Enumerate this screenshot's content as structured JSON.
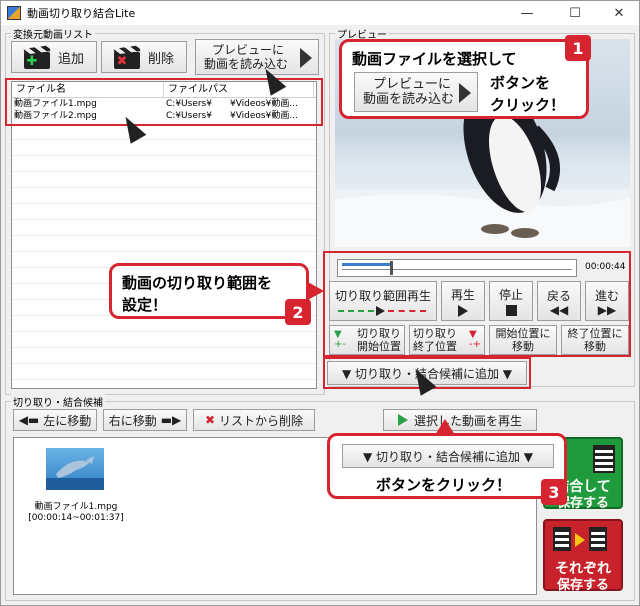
{
  "window": {
    "title": "動画切り取り結合Lite",
    "minimize": "—",
    "maximize": "☐",
    "close": "✕"
  },
  "source_list": {
    "group_label": "変換元動画リスト",
    "add_label": "追加",
    "delete_label": "削除",
    "load_preview_line1": "プレビューに",
    "load_preview_line2": "動画を読み込む",
    "columns": [
      "ファイル名",
      "ファイルパス"
    ],
    "rows": [
      {
        "name": "動画ファイル1.mpg",
        "path": "C:¥Users¥　　¥Videos¥動画..."
      },
      {
        "name": "動画ファイル2.mpg",
        "path": "C:¥Users¥　　¥Videos¥動画..."
      }
    ]
  },
  "preview": {
    "group_label": "プレビュー",
    "time": "00:00:44"
  },
  "controls": {
    "range_play": "切り取り範囲再生",
    "play": "再生",
    "stop": "停止",
    "back": "戻る",
    "forward": "進む",
    "set_start_1": "切り取り",
    "set_start_2": "開始位置",
    "set_end_1": "切り取り",
    "set_end_2": "終了位置",
    "goto_start_1": "開始位置に",
    "goto_start_2": "移動",
    "goto_end_1": "終了位置に",
    "goto_end_2": "移動",
    "add_candidate": "▼ 切り取り・結合候補に追加 ▼"
  },
  "candidates": {
    "group_label": "切り取り・結合候補",
    "move_left": "左に移動",
    "move_right": "右に移動",
    "remove": "リストから削除",
    "play_selected": "選択した動画を再生",
    "item_name": "動画ファイル1.mpg",
    "item_range": "[00:00:14~00:01:37]"
  },
  "save": {
    "combine_line1": "結合して",
    "combine_line2": "保存する",
    "each_line1": "それぞれ",
    "each_line2": "保存する"
  },
  "callouts": {
    "c1_line1": "動画ファイルを選択して",
    "c1_btn_line1": "プレビューに",
    "c1_btn_line2": "動画を読み込む",
    "c1_line2": "ボタンを",
    "c1_line3": "クリック！",
    "c1_num": "1",
    "c2_line1": "動画の切り取り範囲を",
    "c2_line2": "設定！",
    "c2_num": "2",
    "c3_btn": "▼ 切り取り・結合候補に追加 ▼",
    "c3_line": "ボタンをクリック！",
    "c3_num": "3"
  },
  "colors": {
    "accent_red": "#d62430",
    "save_green": "#1f9a3c",
    "save_red": "#c8232c"
  }
}
